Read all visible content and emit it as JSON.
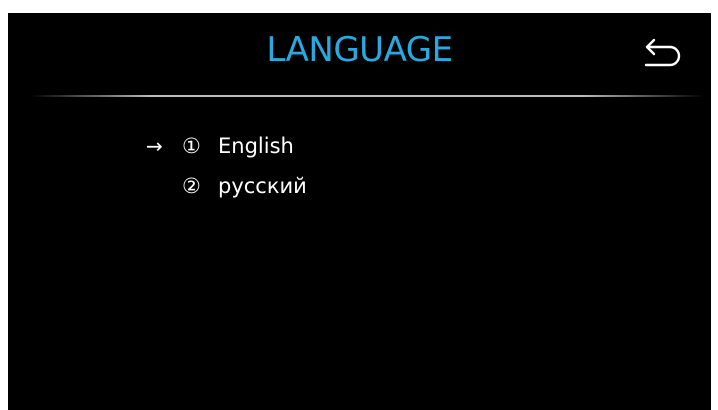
{
  "header": {
    "title": "LANGUAGE",
    "title_color": "#29a9e0",
    "back_icon": "back-arrow-icon"
  },
  "languages": {
    "selection_marker": "→",
    "items": [
      {
        "number": "①",
        "label": "English",
        "selected": true
      },
      {
        "number": "②",
        "label": "русский",
        "selected": false
      }
    ]
  }
}
